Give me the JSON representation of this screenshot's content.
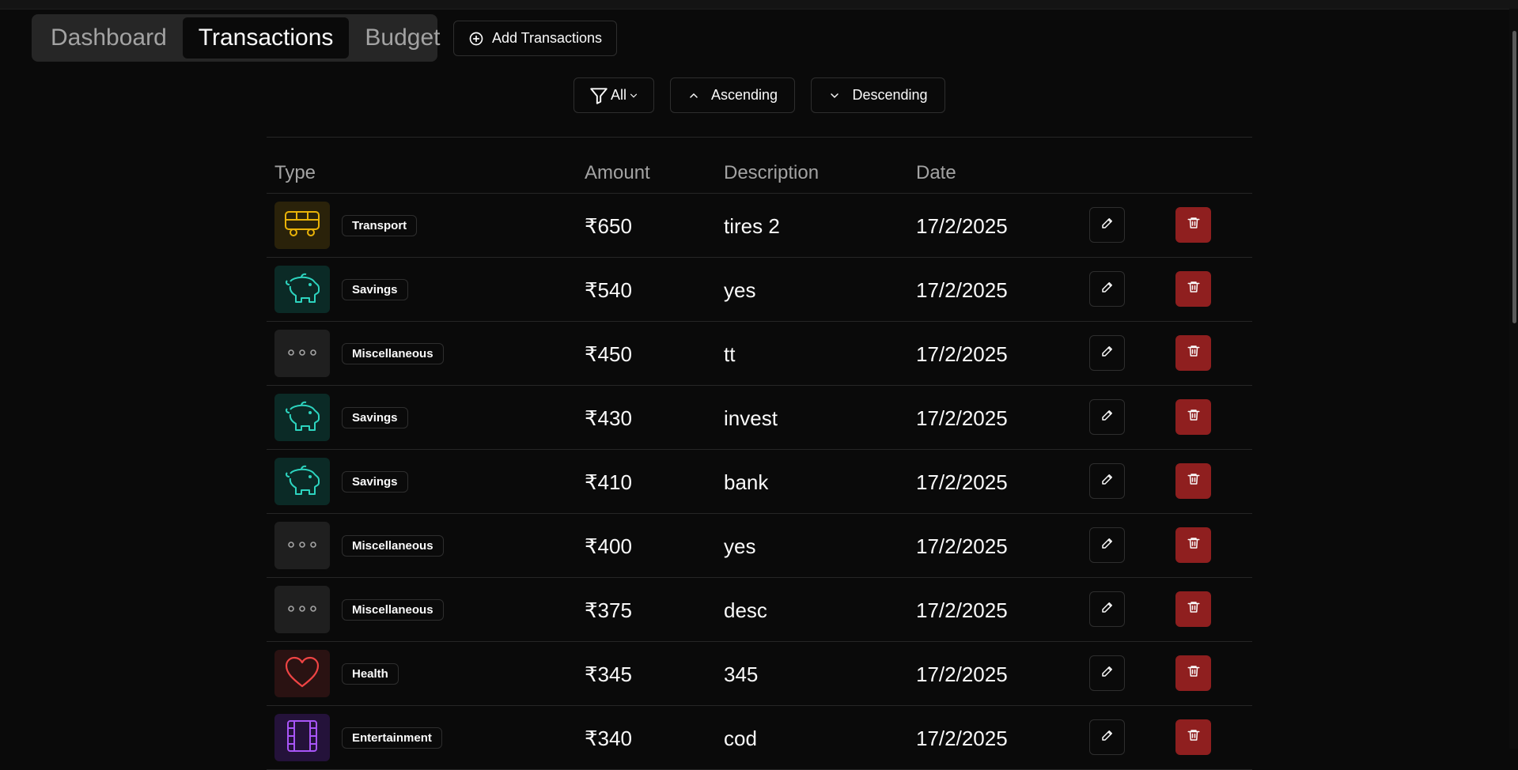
{
  "nav": {
    "tabs": [
      {
        "label": "Dashboard",
        "active": false
      },
      {
        "label": "Transactions",
        "active": true
      },
      {
        "label": "Budget",
        "active": false
      }
    ],
    "add_button_label": "Add Transactions"
  },
  "filters": {
    "filter_label": "All",
    "ascending_label": "Ascending",
    "descending_label": "Descending"
  },
  "table": {
    "headers": {
      "type": "Type",
      "amount": "Amount",
      "description": "Description",
      "date": "Date"
    },
    "rows": [
      {
        "category": "Transport",
        "icon": "bus-icon",
        "amount": "₹650",
        "description": "tires 2",
        "date": "17/2/2025"
      },
      {
        "category": "Savings",
        "icon": "piggy-bank-icon",
        "amount": "₹540",
        "description": "yes",
        "date": "17/2/2025"
      },
      {
        "category": "Miscellaneous",
        "icon": "ellipsis-icon",
        "amount": "₹450",
        "description": "tt",
        "date": "17/2/2025"
      },
      {
        "category": "Savings",
        "icon": "piggy-bank-icon",
        "amount": "₹430",
        "description": "invest",
        "date": "17/2/2025"
      },
      {
        "category": "Savings",
        "icon": "piggy-bank-icon",
        "amount": "₹410",
        "description": "bank",
        "date": "17/2/2025"
      },
      {
        "category": "Miscellaneous",
        "icon": "ellipsis-icon",
        "amount": "₹400",
        "description": "yes",
        "date": "17/2/2025"
      },
      {
        "category": "Miscellaneous",
        "icon": "ellipsis-icon",
        "amount": "₹375",
        "description": "desc",
        "date": "17/2/2025"
      },
      {
        "category": "Health",
        "icon": "heart-icon",
        "amount": "₹345",
        "description": "345",
        "date": "17/2/2025"
      },
      {
        "category": "Entertainment",
        "icon": "film-icon",
        "amount": "₹340",
        "description": "cod",
        "date": "17/2/2025"
      }
    ]
  },
  "colors": {
    "background": "#0a0a0a",
    "transport": "#eab308",
    "savings": "#2dd4bf",
    "miscellaneous": "#a3a3a3",
    "health": "#ef4444",
    "entertainment": "#a855f7",
    "delete": "#8f1f1f"
  }
}
